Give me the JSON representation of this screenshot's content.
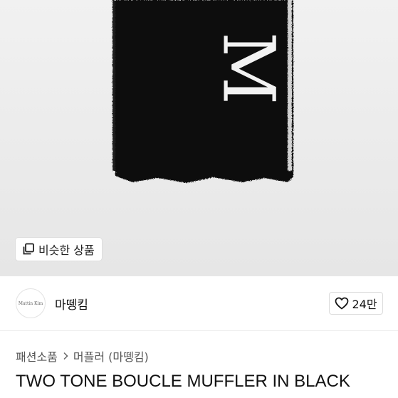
{
  "hero": {
    "product_image": "scarf-image",
    "logo_letter": "M",
    "similar_label": "비슷한 상품"
  },
  "shop": {
    "avatar_text": "Mattin Kim",
    "name": "마뗑킴",
    "like_count": "24만"
  },
  "breadcrumb": {
    "category": "패션소품",
    "subcategory": "머플러 (마뗑킴)"
  },
  "product": {
    "title": "TWO TONE BOUCLE MUFFLER IN BLACK"
  },
  "colors": {
    "scarf": "#0b0b0b",
    "hero_bg": "#eaeaea",
    "text": "#111111"
  }
}
